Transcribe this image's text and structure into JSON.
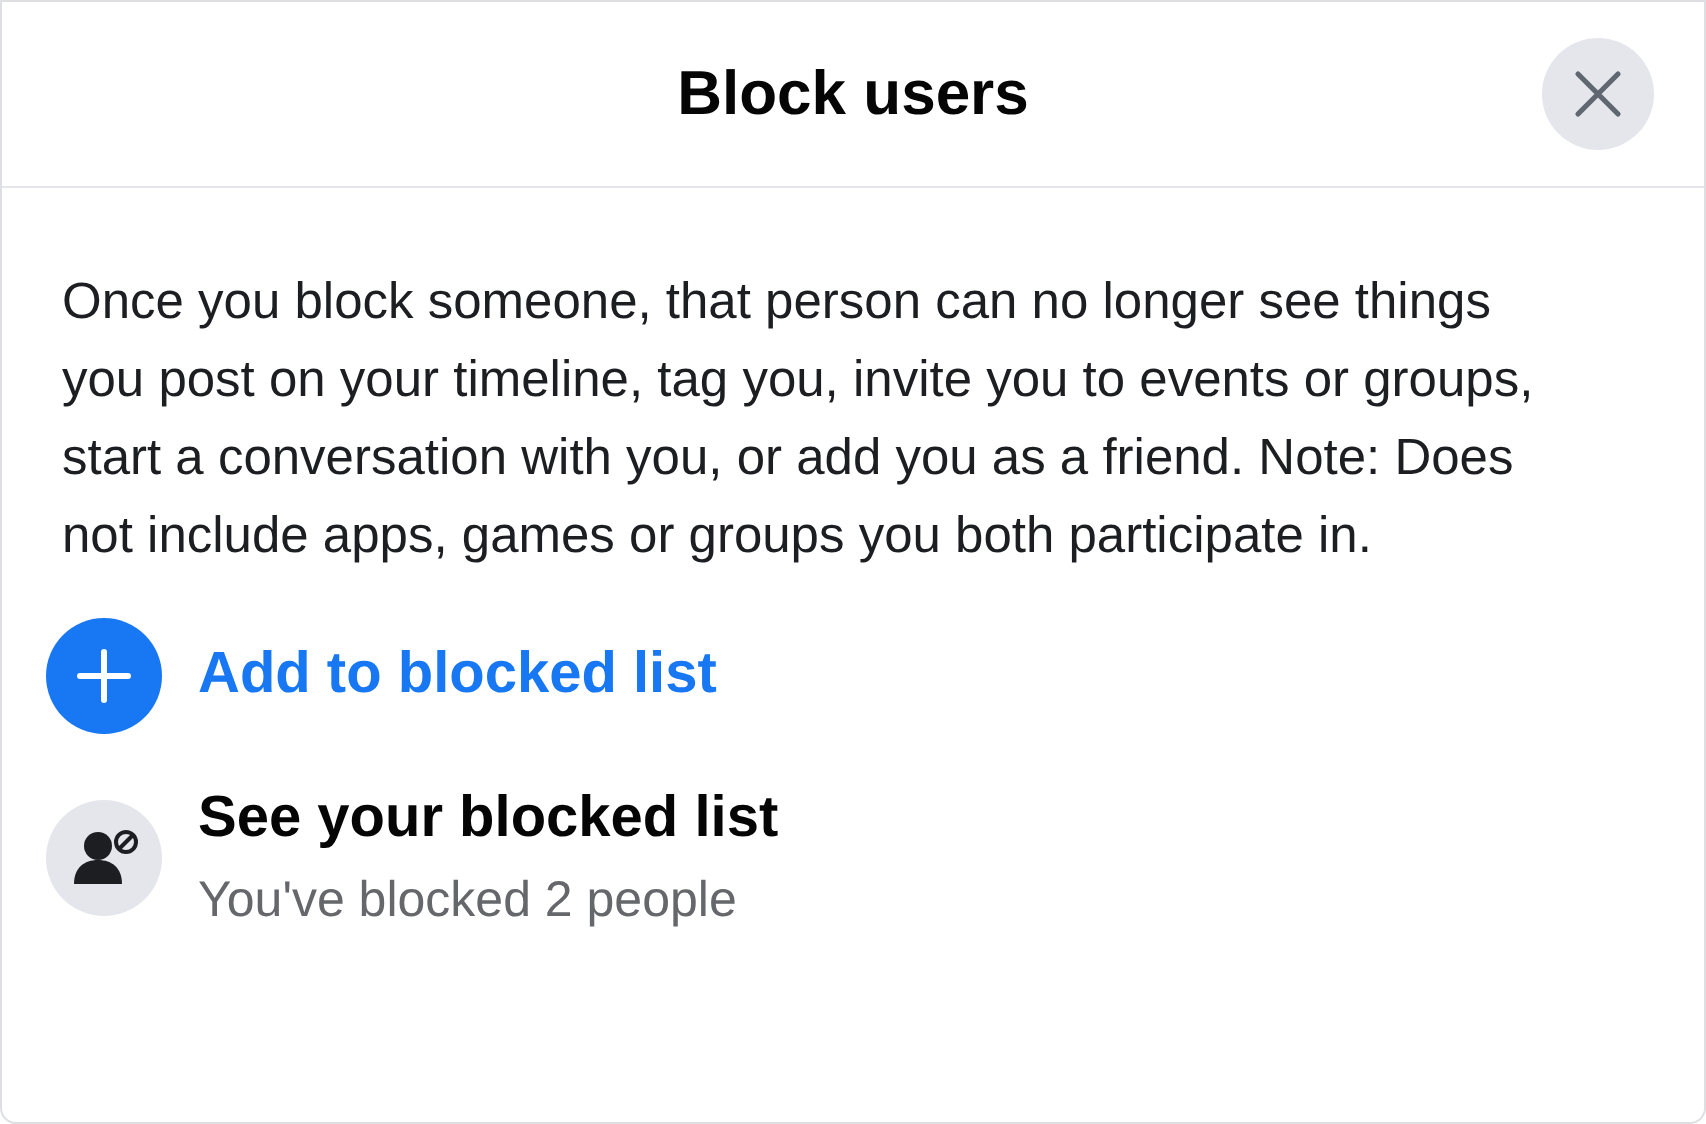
{
  "dialog": {
    "title": "Block users"
  },
  "description": "Once you block someone, that person can no longer see things you post on your timeline, tag you, invite you to events or groups, start a conversation with you, or add you as a friend. Note: Does not include apps, games or groups you both participate in.",
  "actions": [
    {
      "kind": "add",
      "title": "Add to blocked list"
    },
    {
      "kind": "list",
      "title": "See your blocked list",
      "subtitle": "You've blocked 2 people"
    }
  ]
}
